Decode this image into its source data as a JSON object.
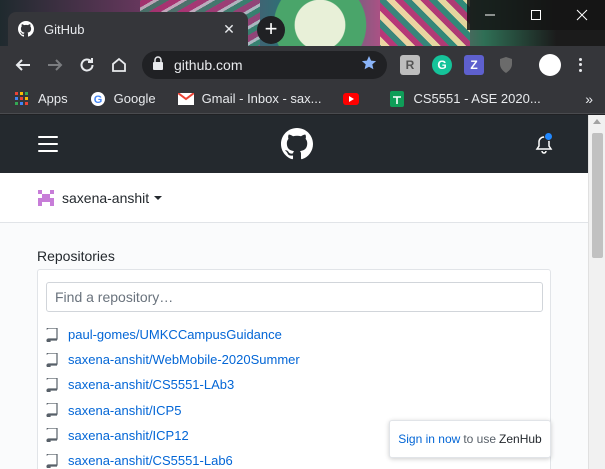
{
  "browser": {
    "tab": {
      "title": "GitHub",
      "close_glyph": "✕"
    },
    "new_tab_glyph": "+",
    "url": "github.com",
    "colors": {
      "tab_bg": "#35363a",
      "frame_bg": "#202124",
      "bookmark_star": "#8ab4f8"
    }
  },
  "bookmarks": {
    "items": [
      {
        "label": "Apps",
        "icon": "apps-grid-icon"
      },
      {
        "label": "Google",
        "icon": "google-icon"
      },
      {
        "label": "Gmail - Inbox - sax...",
        "icon": "gmail-icon"
      },
      {
        "label": "",
        "icon": "youtube-icon"
      },
      {
        "label": "CS5551 - ASE 2020...",
        "icon": "sheets-icon"
      }
    ],
    "more_glyph": "»"
  },
  "github": {
    "header_colors": {
      "bg": "#24292e",
      "notification_dot": "#2188ff"
    },
    "username": "saxena-anshit",
    "repositories_heading": "Repositories",
    "search_placeholder": "Find a repository…",
    "repositories": [
      "paul-gomes/UMKCCampusGuidance",
      "saxena-anshit/WebMobile-2020Summer",
      "saxena-anshit/CS5551-LAb3",
      "saxena-anshit/ICP5",
      "saxena-anshit/ICP12",
      "saxena-anshit/CS5551-Lab6"
    ],
    "link_color": "#0366d6"
  },
  "zenhub": {
    "signin_text": "Sign in now",
    "middle_text": "to use",
    "brand_text": "ZenHub"
  }
}
